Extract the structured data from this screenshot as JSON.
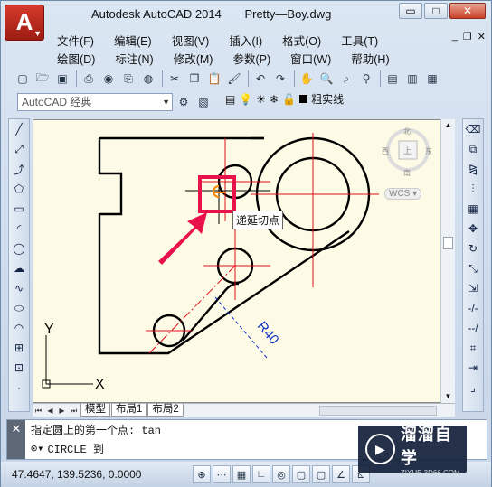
{
  "app": {
    "logo_letter": "A",
    "title_app": "Autodesk AutoCAD 2014",
    "title_file": "Pretty—Boy.dwg",
    "win_min": "▭",
    "win_max": "□",
    "win_close": "✕",
    "mdi_min": "_",
    "mdi_restore": "❐",
    "mdi_close": "✕"
  },
  "menu": {
    "row1": [
      "文件(F)",
      "编辑(E)",
      "视图(V)",
      "插入(I)",
      "格式(O)",
      "工具(T)"
    ],
    "row2": [
      "绘图(D)",
      "标注(N)",
      "修改(M)",
      "参数(P)",
      "窗口(W)",
      "帮助(H)"
    ]
  },
  "workspace": {
    "value": "AutoCAD 经典"
  },
  "layer": {
    "name": "粗实线"
  },
  "canvas": {
    "tooltip": "递延切点",
    "dimension_label": "R40",
    "viewcube": {
      "north": "北",
      "south": "南",
      "east": "东",
      "west": "西",
      "top": "上",
      "wcs": "WCS"
    },
    "ucs_x": "X",
    "ucs_y": "Y",
    "colors": {
      "background": "#fdfbe6",
      "geometry": "#000000",
      "center": "#e0101a",
      "dimension": "#1030c8",
      "highlight": "#e8114a"
    }
  },
  "tabs": {
    "model": "模型",
    "layout1": "布局1",
    "layout2": "布局2"
  },
  "command": {
    "history": "指定圆上的第一个点: tan",
    "prompt": "CIRCLE 到",
    "close_glyph": "✕"
  },
  "status": {
    "coords": "47.4647,  139.5236, 0.0000"
  },
  "watermark": {
    "title": "溜溜自学",
    "subtitle": "ZIXUE.3D66.COM"
  }
}
